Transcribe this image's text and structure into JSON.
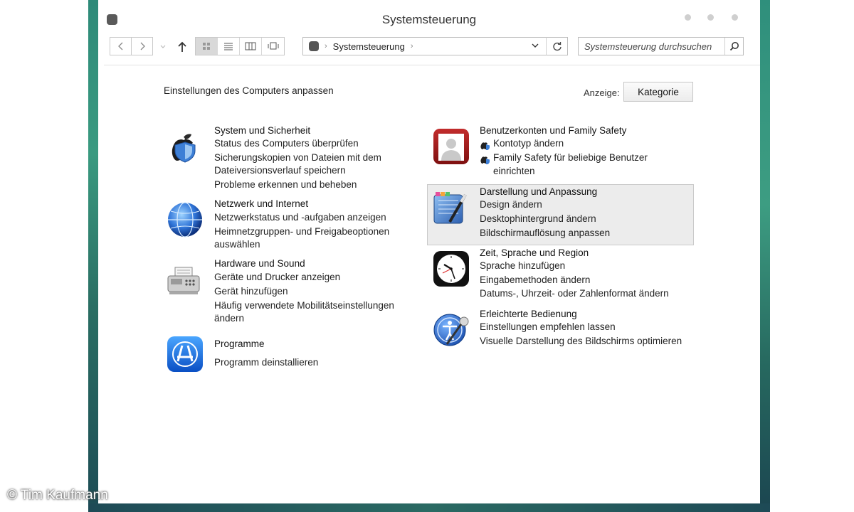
{
  "window": {
    "title": "Systemsteuerung"
  },
  "toolbar": {
    "breadcrumb": [
      "Systemsteuerung"
    ],
    "search_placeholder": "Systemsteuerung durchsuchen"
  },
  "main": {
    "heading": "Einstellungen des Computers anpassen",
    "view_label": "Anzeige:",
    "view_value": "Kategorie"
  },
  "categories_left": [
    {
      "title": "System und Sicherheit",
      "links": [
        "Status des Computers überprüfen",
        "Sicherungskopien von Dateien mit dem",
        "Dateiversionsverlauf speichern",
        "Probleme erkennen und beheben"
      ]
    },
    {
      "title": "Netzwerk und Internet",
      "links": [
        "Netzwerkstatus und -aufgaben anzeigen",
        "Heimnetzgruppen- und Freigabeoptionen",
        "auswählen"
      ]
    },
    {
      "title": "Hardware und Sound",
      "links": [
        "Geräte und Drucker anzeigen",
        "Gerät hinzufügen",
        "Häufig verwendete Mobilitätseinstellungen",
        "ändern"
      ]
    },
    {
      "title": "Programme",
      "links": [
        "Programm deinstallieren"
      ]
    }
  ],
  "categories_right": [
    {
      "title": "Benutzerkonten und Family Safety",
      "links": [
        "Kontotyp ändern",
        "Family Safety für beliebige Benutzer",
        "einrichten"
      ]
    },
    {
      "title": "Darstellung und Anpassung",
      "links": [
        "Design ändern",
        "Desktophintergrund ändern",
        "Bildschirmauflösung anpassen"
      ]
    },
    {
      "title": "Zeit, Sprache und Region",
      "links": [
        "Sprache hinzufügen",
        "Eingabemethoden ändern",
        "Datums-, Uhrzeit- oder Zahlenformat ändern"
      ]
    },
    {
      "title": "Erleichterte Bedienung",
      "links": [
        "Einstellungen empfehlen lassen",
        "Visuelle Darstellung des Bildschirms optimieren"
      ]
    }
  ],
  "watermark": "© Tim Kaufmann"
}
